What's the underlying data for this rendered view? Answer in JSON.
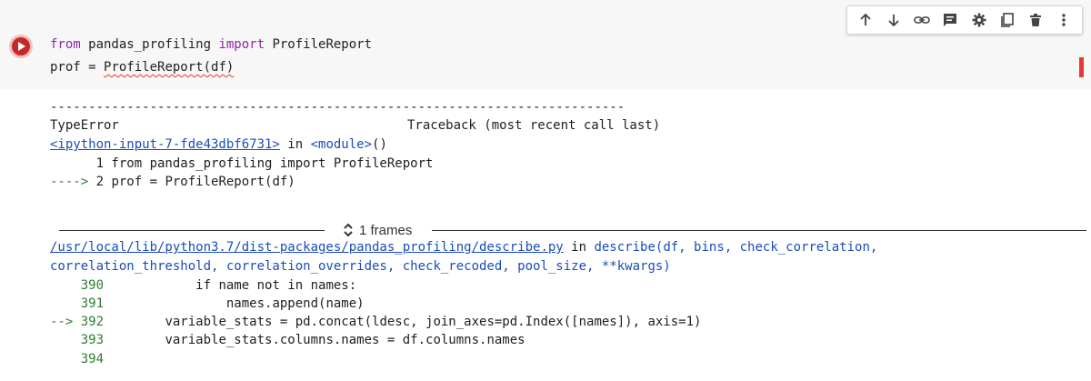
{
  "toolbar": {
    "buttons": [
      {
        "name": "move-up-icon"
      },
      {
        "name": "move-down-icon"
      },
      {
        "name": "link-icon"
      },
      {
        "name": "comment-icon"
      },
      {
        "name": "settings-icon"
      },
      {
        "name": "mirror-cell-icon"
      },
      {
        "name": "delete-icon"
      },
      {
        "name": "more-options-icon"
      }
    ]
  },
  "code": {
    "line1_kw1": "from",
    "line1_mid": " pandas_profiling ",
    "line1_kw2": "import",
    "line1_end": " ProfileReport",
    "line2_a": "prof = ",
    "line2_b": "ProfileReport(df)"
  },
  "output": {
    "dashes": "---------------------------------------------------------------------------",
    "error_type": "TypeError",
    "traceback_header": "Traceback (most recent call last)",
    "frame1_link": "<ipython-input-7-fde43dbf6731>",
    "frame1_in": " in ",
    "frame1_module": "<module>",
    "frame1_parens": "()",
    "frame1_line1": "      1 from pandas_profiling import ProfileReport",
    "frame1_arrow": "---->",
    "frame1_line2": " 2 prof = ProfileReport(df)",
    "frames_label": "1 frames",
    "frame2_link": "/usr/local/lib/python3.7/dist-packages/pandas_profiling/describe.py",
    "frame2_in": " in ",
    "frame2_func": "describe",
    "frame2_args": "(df, bins, check_correlation,",
    "frame2_args2": "correlation_threshold, correlation_overrides, check_recoded, pool_size, **kwargs)",
    "src_lines": [
      {
        "prefix": "    ",
        "num": "390",
        "code": "            if name not in names:"
      },
      {
        "prefix": "    ",
        "num": "391",
        "code": "                names.append(name)"
      },
      {
        "prefix": "--> ",
        "num": "392",
        "code": "        variable_stats = pd.concat(ldesc, join_axes=pd.Index([names]), axis=1)"
      },
      {
        "prefix": "    ",
        "num": "393",
        "code": "        variable_stats.columns.names = df.columns.names"
      },
      {
        "prefix": "    ",
        "num": "394",
        "code": ""
      }
    ]
  },
  "colors": {
    "run_button": "#c62828",
    "keyword": "#8e24aa",
    "link": "#1a4dbb",
    "arrow_green": "#2e7d32",
    "error_marker": "#e53935"
  }
}
